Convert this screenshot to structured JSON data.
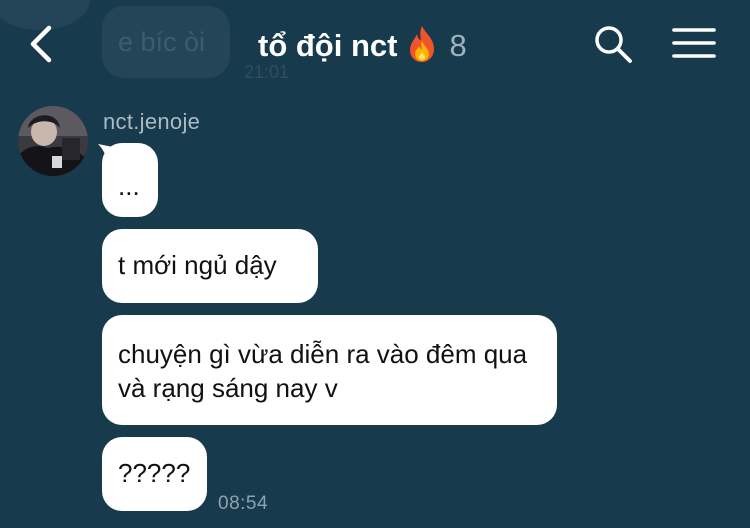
{
  "header": {
    "title": "tổ đội nct",
    "member_count": "8"
  },
  "previous_message": {
    "text": "e bíc òi",
    "time": "21:01"
  },
  "sender": {
    "name": "nct.jenoje"
  },
  "messages": [
    {
      "text": "..."
    },
    {
      "text": "t mới ngủ dậy"
    },
    {
      "text": "chuyện gì vừa diễn ra vào đêm qua và rạng sáng nay v"
    },
    {
      "text": "?????"
    }
  ],
  "last_message_time": "08:54",
  "icons": {
    "back": "chevron-left-icon",
    "title_emoji": "fire-icon",
    "search": "search-icon",
    "menu": "hamburger-menu-icon"
  },
  "colors": {
    "background": "#173a4d",
    "bubble": "#ffffff",
    "muted_text": "#9fb2bd"
  }
}
